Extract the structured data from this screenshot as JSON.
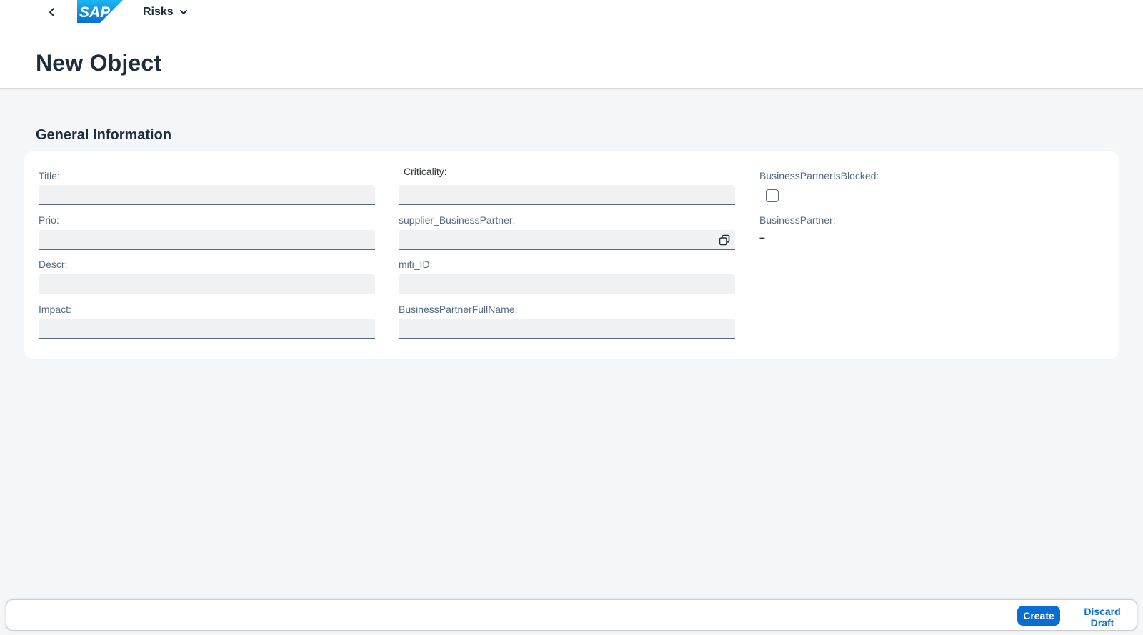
{
  "header": {
    "logo_text": "SAP",
    "app_title": "Risks",
    "page_title": "New Object",
    "brand_color": "#0a6ed1"
  },
  "section": {
    "title": "General Information"
  },
  "form": {
    "column1": [
      {
        "label": "Title:",
        "value": ""
      },
      {
        "label": "Prio:",
        "value": ""
      },
      {
        "label": "Descr:",
        "value": ""
      },
      {
        "label": "Impact:",
        "value": ""
      }
    ],
    "column2": [
      {
        "label": "Criticality:",
        "value": ""
      },
      {
        "label": "supplier_BusinessPartner:",
        "value": "",
        "icon": "value-help-icon"
      },
      {
        "label": "miti_ID:",
        "value": ""
      },
      {
        "label": "BusinessPartnerFullName:",
        "value": ""
      }
    ],
    "column3": [
      {
        "label": "BusinessPartnerIsBlocked:",
        "checked": false
      },
      {
        "label": "BusinessPartner:",
        "value": "–"
      }
    ]
  },
  "footer": {
    "create_label": "Create",
    "discard_label": "Discard Draft"
  }
}
